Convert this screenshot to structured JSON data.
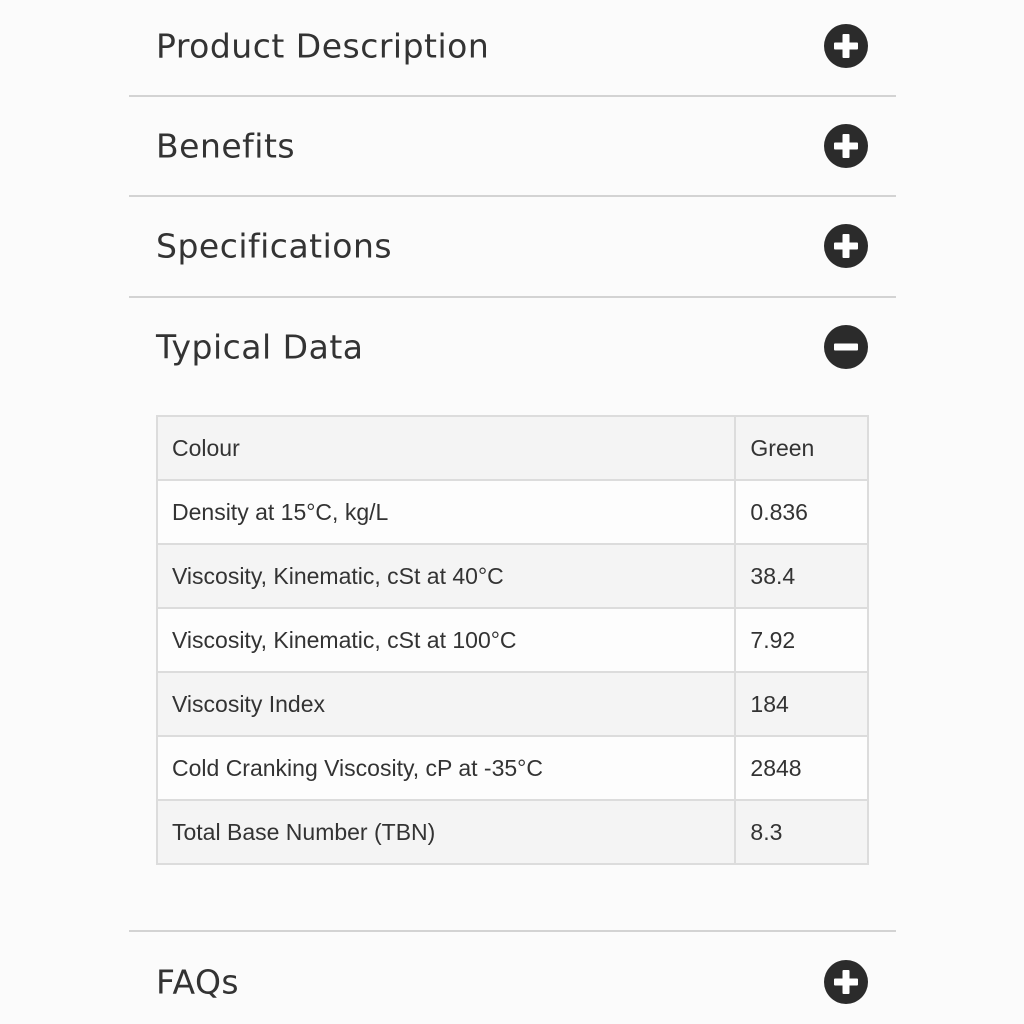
{
  "sections": [
    {
      "title": "Product Description",
      "state": "collapsed",
      "icon": "plus-circle-icon"
    },
    {
      "title": "Benefits",
      "state": "collapsed",
      "icon": "plus-circle-icon"
    },
    {
      "title": "Specifications",
      "state": "collapsed",
      "icon": "plus-circle-icon"
    },
    {
      "title": "Typical Data",
      "state": "expanded",
      "icon": "minus-circle-icon"
    },
    {
      "title": "FAQs",
      "state": "collapsed",
      "icon": "plus-circle-icon"
    }
  ],
  "typical_data": {
    "rows": [
      {
        "property": "Colour",
        "value": "Green"
      },
      {
        "property": "Density at 15°C, kg/L",
        "value": "0.836"
      },
      {
        "property": "Viscosity, Kinematic, cSt at 40°C",
        "value": "38.4"
      },
      {
        "property": "Viscosity, Kinematic, cSt at 100°C",
        "value": "7.92"
      },
      {
        "property": "Viscosity Index",
        "value": "184"
      },
      {
        "property": "Cold Cranking Viscosity, cP at -35°C",
        "value": "2848"
      },
      {
        "property": "Total Base Number (TBN)",
        "value": "8.3"
      }
    ]
  },
  "colors": {
    "icon_fill": "#2b2b2b",
    "divider": "#d3d3d3",
    "table_border": "#dcdcdc",
    "background": "#fbfbfb"
  }
}
